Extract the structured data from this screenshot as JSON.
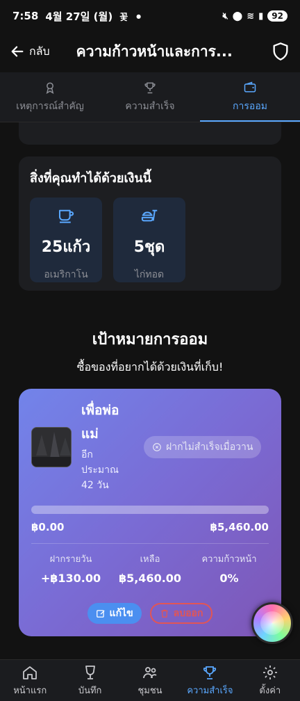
{
  "status_bar": {
    "time": "7:58",
    "date": "4월 27일 (월)",
    "extra": "꽃",
    "battery": "92"
  },
  "app_bar": {
    "back_label": "กลับ",
    "title": "ความก้าวหน้าและการ..."
  },
  "tabs": [
    {
      "label": "เหตุการณ์สำคัญ",
      "icon": "award-icon",
      "active": false
    },
    {
      "label": "ความสำเร็จ",
      "icon": "trophy-icon",
      "active": false
    },
    {
      "label": "การออม",
      "icon": "wallet-icon",
      "active": true
    }
  ],
  "spend": {
    "title": "สิ่งที่คุณทำได้ด้วยเงินนี้",
    "items": [
      {
        "value": "25แก้ว",
        "label": "อเมริกาโน",
        "icon": "coffee-cup-icon"
      },
      {
        "value": "5ชุด",
        "label": "ไก่ทอด",
        "icon": "fastfood-icon"
      }
    ]
  },
  "goals": {
    "title": "เป้าหมายการออม",
    "subtitle": "ซื้อของที่อยากได้ด้วยเงินที่เก็บ!",
    "card": {
      "name_line1": "เพื่อพ่อ",
      "name_line2": "แม่",
      "eta_line1": "อีก",
      "eta_line2": "ประมาณ",
      "eta_line3": "42 วัน",
      "fail_badge": "ฝากไม่สำเร็จเมื่อวาน",
      "progress_fraction": 0,
      "amount_saved": "฿0.00",
      "amount_target": "฿5,460.00",
      "stats": [
        {
          "label": "ฝากรายวัน",
          "value": "+฿130.00"
        },
        {
          "label": "เหลือ",
          "value": "฿5,460.00"
        },
        {
          "label": "ความก้าวหน้า",
          "value": "0%"
        }
      ],
      "edit_label": "แก้ไข",
      "delete_label": "ลบออก"
    }
  },
  "bottom_nav": [
    {
      "label": "หน้าแรก",
      "icon": "home-icon",
      "active": false
    },
    {
      "label": "บันทึก",
      "icon": "glass-icon",
      "active": false
    },
    {
      "label": "ชุมชน",
      "icon": "people-icon",
      "active": false
    },
    {
      "label": "ความสำเร็จ",
      "icon": "trophy-icon",
      "active": true
    },
    {
      "label": "ตั้งค่า",
      "icon": "gear-icon",
      "active": false
    }
  ],
  "colors": {
    "accent": "#5aa8ff",
    "background": "#121212",
    "card": "#1d1e21",
    "danger": "#e25555"
  }
}
